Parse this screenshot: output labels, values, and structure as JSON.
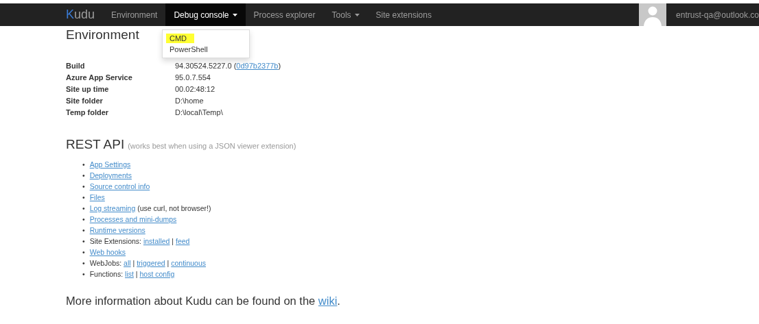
{
  "navbar": {
    "logo": "Kudu",
    "items": [
      {
        "label": "Environment",
        "dropdown": false,
        "selected": false
      },
      {
        "label": "Debug console",
        "dropdown": true,
        "selected": true
      },
      {
        "label": "Process explorer",
        "dropdown": false,
        "selected": false
      },
      {
        "label": "Tools",
        "dropdown": true,
        "selected": false
      },
      {
        "label": "Site extensions",
        "dropdown": false,
        "selected": false
      }
    ],
    "user": "entrust-qa@outlook.co"
  },
  "dropdown_menu": [
    {
      "label": "CMD",
      "selected": true
    },
    {
      "label": "PowerShell",
      "selected": false
    }
  ],
  "environment": {
    "title": "Environment",
    "rows": [
      {
        "label": "Build",
        "value": [
          {
            "text": "94.30524.5227.0 (",
            "link": false
          },
          {
            "text": "0d97b2377b",
            "link": true
          },
          {
            "text": ")",
            "link": false
          }
        ]
      },
      {
        "label": "Azure App Service",
        "value": [
          {
            "text": "95.0.7.554",
            "link": false
          }
        ]
      },
      {
        "label": "Site up time",
        "value": [
          {
            "text": "00.02:48:12",
            "link": false
          }
        ]
      },
      {
        "label": "Site folder",
        "value": [
          {
            "text": "D:\\home",
            "link": false
          }
        ]
      },
      {
        "label": "Temp folder",
        "value": [
          {
            "text": "D:\\local\\Temp\\",
            "link": false
          }
        ]
      }
    ]
  },
  "rest_api": {
    "title": "REST API",
    "bullet": "•",
    "note": "(works best when using a JSON viewer extension)",
    "items": [
      [
        {
          "text": "App Settings",
          "link": true
        }
      ],
      [
        {
          "text": "Deployments",
          "link": true
        }
      ],
      [
        {
          "text": "Source control info",
          "link": true
        }
      ],
      [
        {
          "text": "Files",
          "link": true
        }
      ],
      [
        {
          "text": "Log streaming",
          "link": true
        },
        {
          "text": "(use curl, not browser!)",
          "link": false
        }
      ],
      [
        {
          "text": "Processes and mini-dumps",
          "link": true
        }
      ],
      [
        {
          "text": "Runtime versions",
          "link": true
        }
      ],
      [
        {
          "text": "Site Extensions:",
          "link": false
        },
        {
          "text": "installed",
          "link": true
        },
        {
          "text": "|",
          "link": false
        },
        {
          "text": "feed",
          "link": true
        }
      ],
      [
        {
          "text": "Web hooks",
          "link": true
        }
      ],
      [
        {
          "text": "WebJobs:",
          "link": false
        },
        {
          "text": "all",
          "link": true
        },
        {
          "text": "|",
          "link": false
        },
        {
          "text": "triggered",
          "link": true
        },
        {
          "text": "|",
          "link": false
        },
        {
          "text": "continuous",
          "link": true
        }
      ],
      [
        {
          "text": "Functions:",
          "link": false
        },
        {
          "text": "list",
          "link": true
        },
        {
          "text": "|",
          "link": false
        },
        {
          "text": "host config",
          "link": true
        }
      ]
    ]
  },
  "footer": {
    "text": "More information about Kudu can be found on the",
    "link": "wiki",
    "end": "."
  }
}
